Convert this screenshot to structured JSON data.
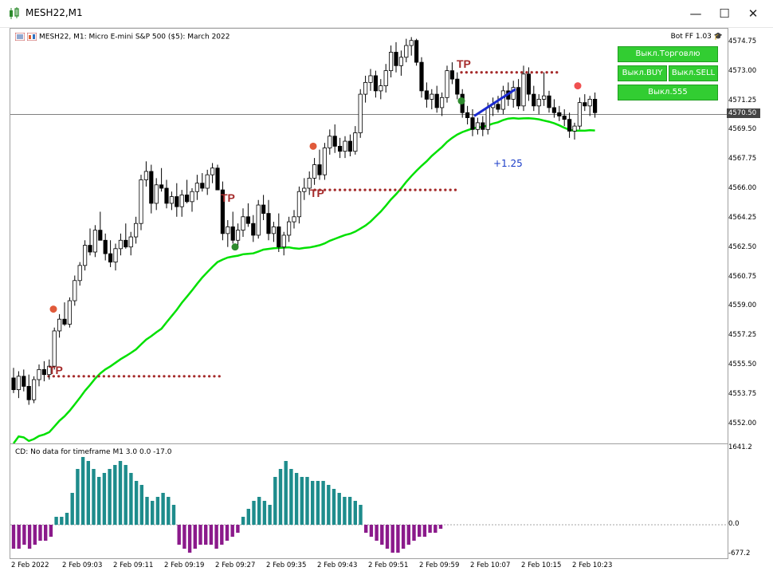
{
  "window": {
    "title": "MESH22,M1"
  },
  "chart": {
    "header": "MESH22, M1:  Micro E-mini S&P 500 ($5): March 2022",
    "bot_label": "Bot FF 1.03",
    "buttons": {
      "trade_off": "Выкл.Торговлю",
      "buy_off": "Выкл.BUY",
      "sell_off": "Выкл.SELL",
      "off_555": "Выкл.555"
    },
    "current_price": "4570.50",
    "price_axis": [
      "4574.75",
      "4573.00",
      "4571.25",
      "4569.50",
      "4567.75",
      "4566.00",
      "4564.25",
      "4562.50",
      "4560.75",
      "4559.00",
      "4557.25",
      "4555.50",
      "4553.75",
      "4552.00"
    ],
    "tp_label": "TP",
    "profit_label": "+1.25"
  },
  "indicator": {
    "header": "CD: No data for timeframe M1 3.0 0.0 -17.0",
    "axis": [
      "1641.2",
      "0.0",
      "-677.2"
    ]
  },
  "time_axis": [
    "2 Feb 2022",
    "2 Feb 09:03",
    "2 Feb 09:11",
    "2 Feb 09:19",
    "2 Feb 09:27",
    "2 Feb 09:35",
    "2 Feb 09:43",
    "2 Feb 09:51",
    "2 Feb 09:59",
    "2 Feb 10:07",
    "2 Feb 10:15",
    "2 Feb 10:23"
  ],
  "colors": {
    "ma_green": "#00e000",
    "tp_dots": "#a52a2a",
    "hist_teal": "#1e8c8c",
    "hist_purple": "#8b1a8b",
    "button_green": "#32cd32"
  },
  "chart_data": {
    "type": "candlestick",
    "price_range": [
      4550.9,
      4575.6
    ],
    "candles": [
      [
        4554.8,
        4555.4,
        4553.9,
        4554.1
      ],
      [
        4554.1,
        4555.2,
        4553.6,
        4554.9
      ],
      [
        4554.9,
        4555.3,
        4554.0,
        4554.3
      ],
      [
        4554.3,
        4555.0,
        4553.2,
        4553.5
      ],
      [
        4553.5,
        4554.9,
        4553.3,
        4554.7
      ],
      [
        4554.7,
        4555.6,
        4554.3,
        4555.3
      ],
      [
        4555.3,
        4555.8,
        4554.6,
        4555.0
      ],
      [
        4555.0,
        4555.9,
        4554.7,
        4555.5
      ],
      [
        4555.5,
        4557.8,
        4555.3,
        4557.6
      ],
      [
        4557.6,
        4558.6,
        4557.2,
        4558.3
      ],
      [
        4558.3,
        4559.3,
        4557.9,
        4558.0
      ],
      [
        4558.0,
        4559.6,
        4557.8,
        4559.4
      ],
      [
        4559.4,
        4560.9,
        4559.1,
        4560.6
      ],
      [
        4560.6,
        4561.7,
        4560.3,
        4561.5
      ],
      [
        4561.5,
        4563.0,
        4561.2,
        4562.7
      ],
      [
        4562.7,
        4563.7,
        4562.1,
        4562.3
      ],
      [
        4562.3,
        4563.9,
        4562.0,
        4563.6
      ],
      [
        4563.6,
        4564.7,
        4563.2,
        4563.0
      ],
      [
        4563.0,
        4563.4,
        4561.8,
        4562.2
      ],
      [
        4562.2,
        4563.0,
        4561.4,
        4561.7
      ],
      [
        4561.7,
        4562.8,
        4561.2,
        4562.5
      ],
      [
        4562.5,
        4563.4,
        4562.1,
        4563.0
      ],
      [
        4563.0,
        4564.0,
        4562.5,
        4562.6
      ],
      [
        4562.6,
        4563.5,
        4562.1,
        4563.2
      ],
      [
        4563.2,
        4564.4,
        4562.8,
        4564.0
      ],
      [
        4564.0,
        4566.9,
        4563.6,
        4566.6
      ],
      [
        4566.6,
        4567.7,
        4566.2,
        4567.1
      ],
      [
        4567.1,
        4567.5,
        4564.6,
        4565.2
      ],
      [
        4565.2,
        4566.7,
        4564.8,
        4566.3
      ],
      [
        4566.3,
        4567.3,
        4565.9,
        4566.1
      ],
      [
        4566.1,
        4566.6,
        4564.9,
        4565.2
      ],
      [
        4565.2,
        4565.9,
        4564.8,
        4565.6
      ],
      [
        4565.6,
        4566.4,
        4564.4,
        4565.0
      ],
      [
        4565.0,
        4566.0,
        4564.4,
        4565.7
      ],
      [
        4565.7,
        4566.6,
        4565.2,
        4565.3
      ],
      [
        4565.3,
        4566.1,
        4564.7,
        4565.9
      ],
      [
        4565.9,
        4566.9,
        4565.4,
        4566.4
      ],
      [
        4566.4,
        4567.0,
        4565.9,
        4566.1
      ],
      [
        4566.1,
        4567.2,
        4565.7,
        4566.9
      ],
      [
        4566.9,
        4567.6,
        4566.4,
        4567.3
      ],
      [
        4567.3,
        4567.5,
        4566.0,
        4566.0
      ],
      [
        4566.0,
        4566.5,
        4563.0,
        4563.4
      ],
      [
        4563.4,
        4564.2,
        4562.6,
        4563.8
      ],
      [
        4563.8,
        4564.7,
        4562.8,
        4563.0
      ],
      [
        4563.0,
        4564.0,
        4562.6,
        4563.6
      ],
      [
        4563.6,
        4564.9,
        4563.2,
        4564.4
      ],
      [
        4564.4,
        4565.2,
        4563.8,
        4564.0
      ],
      [
        4564.0,
        4564.5,
        4562.9,
        4563.3
      ],
      [
        4563.3,
        4565.4,
        4563.1,
        4565.1
      ],
      [
        4565.1,
        4565.7,
        4564.2,
        4564.6
      ],
      [
        4564.6,
        4565.4,
        4563.0,
        4563.4
      ],
      [
        4563.4,
        4564.1,
        4562.9,
        4563.8
      ],
      [
        4563.8,
        4564.6,
        4562.3,
        4562.6
      ],
      [
        4562.6,
        4563.5,
        4562.1,
        4563.3
      ],
      [
        4563.3,
        4564.4,
        4562.9,
        4564.1
      ],
      [
        4564.1,
        4564.8,
        4563.7,
        4564.4
      ],
      [
        4564.4,
        4566.2,
        4564.0,
        4565.9
      ],
      [
        4565.9,
        4566.7,
        4565.4,
        4566.1
      ],
      [
        4566.1,
        4567.1,
        4565.7,
        4566.7
      ],
      [
        4566.7,
        4567.9,
        4566.3,
        4567.5
      ],
      [
        4567.5,
        4568.4,
        4566.6,
        4566.9
      ],
      [
        4566.9,
        4568.8,
        4566.6,
        4568.5
      ],
      [
        4568.5,
        4569.6,
        4568.1,
        4569.2
      ],
      [
        4569.2,
        4569.9,
        4568.2,
        4568.6
      ],
      [
        4568.6,
        4569.1,
        4567.9,
        4568.3
      ],
      [
        4568.3,
        4569.2,
        4567.9,
        4568.9
      ],
      [
        4568.9,
        4569.3,
        4568.0,
        4568.3
      ],
      [
        4568.3,
        4569.8,
        4568.1,
        4569.4
      ],
      [
        4569.4,
        4572.0,
        4569.1,
        4571.7
      ],
      [
        4571.7,
        4572.8,
        4571.2,
        4572.4
      ],
      [
        4572.4,
        4573.2,
        4571.9,
        4572.8
      ],
      [
        4572.8,
        4573.1,
        4571.5,
        4571.9
      ],
      [
        4571.9,
        4572.6,
        4571.4,
        4572.2
      ],
      [
        4572.2,
        4573.5,
        4571.8,
        4573.1
      ],
      [
        4573.1,
        4574.6,
        4572.7,
        4574.2
      ],
      [
        4574.2,
        4574.8,
        4573.0,
        4573.4
      ],
      [
        4573.4,
        4574.3,
        4572.8,
        4573.9
      ],
      [
        4573.9,
        4575.0,
        4573.6,
        4574.6
      ],
      [
        4574.6,
        4575.1,
        4574.0,
        4574.9
      ],
      [
        4574.9,
        4575.0,
        4573.4,
        4573.6
      ],
      [
        4573.6,
        4573.9,
        4571.5,
        4571.9
      ],
      [
        4571.9,
        4572.4,
        4570.9,
        4571.4
      ],
      [
        4571.4,
        4572.0,
        4570.8,
        4571.7
      ],
      [
        4571.7,
        4572.2,
        4570.6,
        4570.9
      ],
      [
        4570.9,
        4571.8,
        4570.4,
        4571.5
      ],
      [
        4571.5,
        4573.4,
        4571.2,
        4573.1
      ],
      [
        4573.1,
        4573.6,
        4572.3,
        4572.6
      ],
      [
        4572.6,
        4573.0,
        4571.4,
        4571.7
      ],
      [
        4571.7,
        4572.0,
        4570.3,
        4570.6
      ],
      [
        4570.6,
        4571.0,
        4569.9,
        4570.3
      ],
      [
        4570.3,
        4570.8,
        4569.2,
        4569.6
      ],
      [
        4569.6,
        4570.3,
        4569.3,
        4570.0
      ],
      [
        4570.0,
        4570.4,
        4569.2,
        4569.6
      ],
      [
        4569.6,
        4571.2,
        4569.3,
        4570.9
      ],
      [
        4570.9,
        4571.5,
        4570.4,
        4571.1
      ],
      [
        4571.1,
        4571.6,
        4570.6,
        4570.8
      ],
      [
        4570.8,
        4572.2,
        4570.5,
        4571.9
      ],
      [
        4571.9,
        4572.4,
        4571.0,
        4571.4
      ],
      [
        4571.4,
        4572.5,
        4570.9,
        4572.1
      ],
      [
        4572.1,
        4572.6,
        4570.8,
        4571.0
      ],
      [
        4571.0,
        4573.4,
        4570.7,
        4572.9
      ],
      [
        4572.9,
        4573.3,
        4571.3,
        4571.7
      ],
      [
        4571.7,
        4572.2,
        4570.7,
        4571.0
      ],
      [
        4571.0,
        4571.7,
        4570.5,
        4571.4
      ],
      [
        4571.4,
        4573.0,
        4571.0,
        4571.6
      ],
      [
        4571.6,
        4571.9,
        4570.6,
        4570.9
      ],
      [
        4570.9,
        4571.4,
        4570.3,
        4570.6
      ],
      [
        4570.6,
        4571.0,
        4570.1,
        4570.4
      ],
      [
        4570.4,
        4570.8,
        4569.8,
        4570.2
      ],
      [
        4570.2,
        4570.6,
        4569.1,
        4569.5
      ],
      [
        4569.5,
        4570.0,
        4569.0,
        4569.8
      ],
      [
        4569.8,
        4571.5,
        4569.6,
        4571.2
      ],
      [
        4571.2,
        4571.7,
        4570.7,
        4571.0
      ],
      [
        4571.0,
        4571.6,
        4570.4,
        4571.4
      ],
      [
        4571.4,
        4571.8,
        4570.3,
        4570.6
      ]
    ],
    "histogram": [
      -6,
      -6,
      -5,
      -6,
      -5,
      -4,
      -4,
      -3,
      2,
      2,
      3,
      8,
      14,
      17,
      16,
      14,
      12,
      13,
      14,
      15,
      16,
      15,
      13,
      11,
      10,
      7,
      6,
      7,
      8,
      7,
      5,
      -5,
      -6,
      -7,
      -6,
      -5,
      -5,
      -5,
      -6,
      -5,
      -4,
      -3,
      -2,
      2,
      4,
      6,
      7,
      6,
      5,
      12,
      14,
      16,
      14,
      13,
      12,
      12,
      11,
      11,
      11,
      10,
      9,
      8,
      7,
      7,
      6,
      5,
      -2,
      -3,
      -4,
      -5,
      -6,
      -7,
      -7,
      -6,
      -5,
      -4,
      -3,
      -3,
      -2,
      -2,
      -1
    ]
  }
}
